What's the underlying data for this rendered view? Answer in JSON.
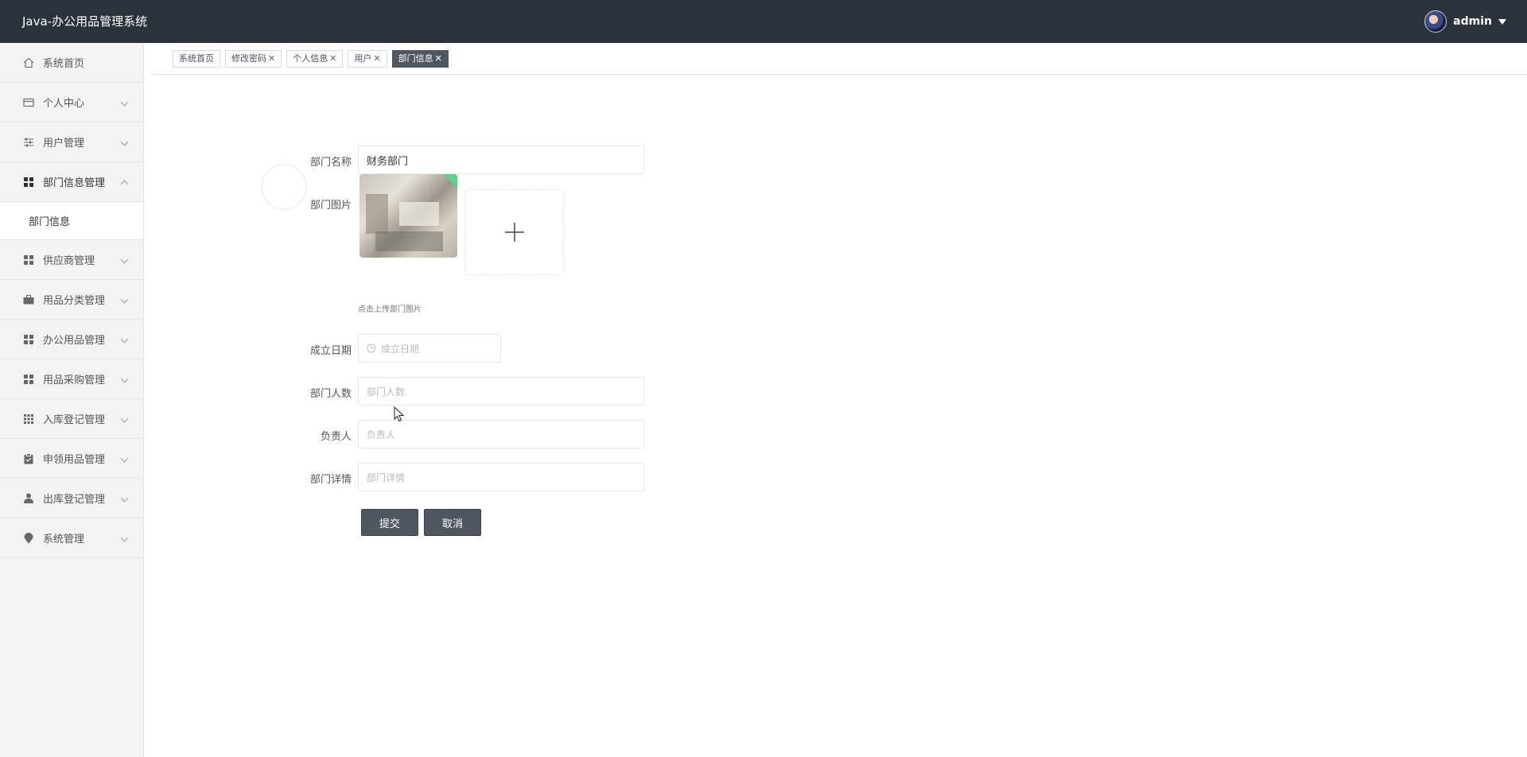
{
  "header": {
    "title": "Java-办公用品管理系统",
    "username": "admin"
  },
  "sidebar": {
    "items": [
      {
        "label": "系统首页",
        "icon": "home-icon"
      },
      {
        "label": "个人中心",
        "icon": "card-icon"
      },
      {
        "label": "用户管理",
        "icon": "sliders-icon"
      },
      {
        "label": "部门信息管理",
        "icon": "grid-icon",
        "expanded": true
      },
      {
        "label": "供应商管理",
        "icon": "grid-icon"
      },
      {
        "label": "用品分类管理",
        "icon": "briefcase-icon"
      },
      {
        "label": "办公用品管理",
        "icon": "grid-icon"
      },
      {
        "label": "用品采购管理",
        "icon": "grid-icon"
      },
      {
        "label": "入库登记管理",
        "icon": "apps-icon"
      },
      {
        "label": "申领用品管理",
        "icon": "clipboard-icon"
      },
      {
        "label": "出库登记管理",
        "icon": "user-icon"
      },
      {
        "label": "系统管理",
        "icon": "pin-icon"
      }
    ],
    "submenu": {
      "label": "部门信息"
    }
  },
  "tags": [
    {
      "label": "系统首页",
      "closable": false
    },
    {
      "label": "修改密码",
      "closable": true
    },
    {
      "label": "个人信息",
      "closable": true
    },
    {
      "label": "用户",
      "closable": true
    },
    {
      "label": "部门信息",
      "closable": true,
      "active": true
    }
  ],
  "form": {
    "dept_name": {
      "label": "部门名称",
      "value": "财务部门"
    },
    "dept_image": {
      "label": "部门图片",
      "hint": "点击上传部门图片"
    },
    "founded_date": {
      "label": "成立日期",
      "placeholder": "成立日期"
    },
    "headcount": {
      "label": "部门人数",
      "placeholder": "部门人数"
    },
    "manager": {
      "label": "负责人",
      "placeholder": "负责人"
    },
    "details": {
      "label": "部门详情",
      "placeholder": "部门详情"
    },
    "submit_label": "提交",
    "cancel_label": "取消"
  },
  "colors": {
    "header_bg": "#2b323b",
    "active_tag": "#50565f",
    "button": "#50565f"
  }
}
